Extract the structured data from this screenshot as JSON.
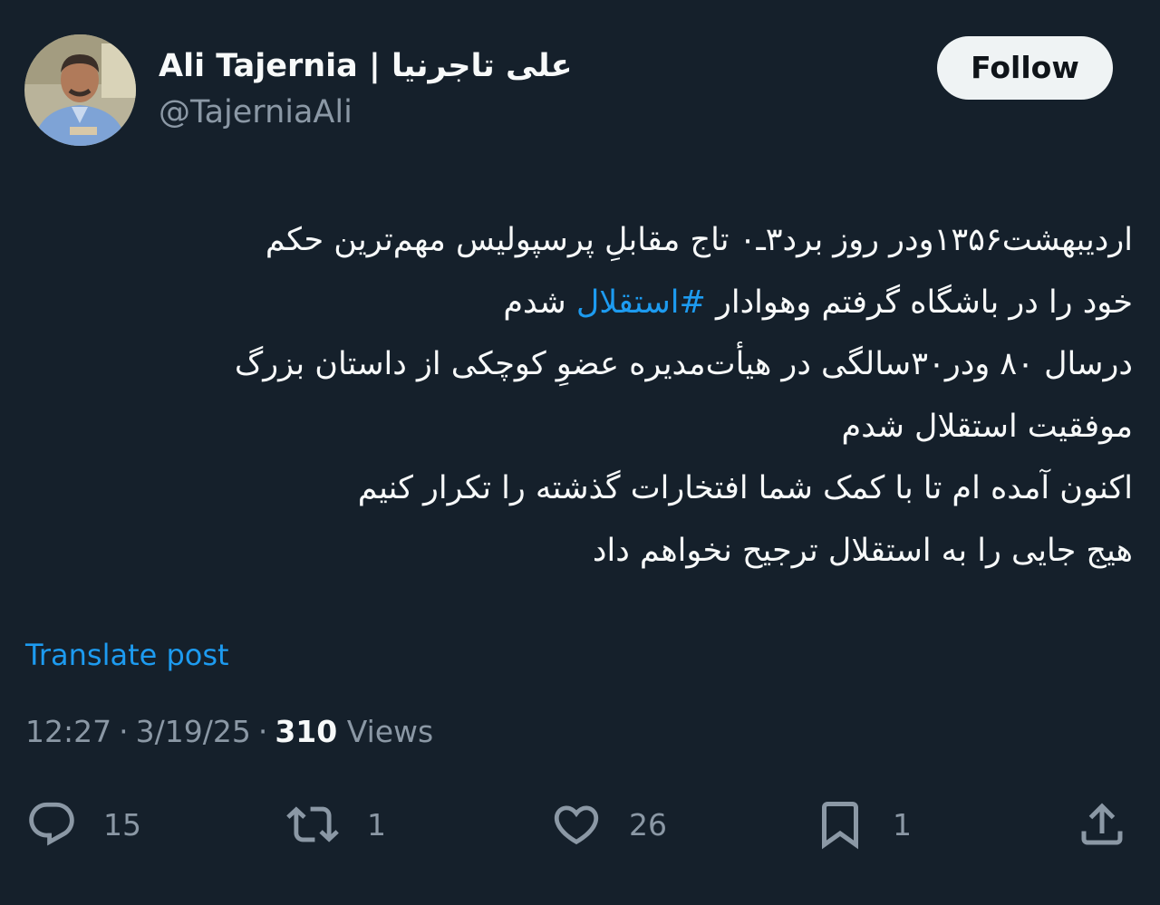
{
  "author": {
    "display_name": "Ali Tajernia | علی تاجرنیا",
    "handle": "@TajerniaAli"
  },
  "follow_label": "Follow",
  "post": {
    "line1": "اردیبهشت۱۳۵۶ودر روز برد۳ـ۰ تاج مقابلِ پرسپولیس مهم‌ترین حکم",
    "line2_text": "خود را در باشگاه گرفتم وهوادار ",
    "hashtag": "#استقلال",
    "line2_tail": " شدم",
    "line3": "درسال ۸۰ ودر۳۰سالگی در هیأت‌مدیره عضوِ کوچکی از داستان بزرگ",
    "line4": "موفقیت استقلال شدم",
    "line5": "اکنون آمده ام تا با کمک شما افتخارات گذشته را تکرار کنیم",
    "line6": "هیج جایی را به استقلال ترجیح نخواهم داد"
  },
  "translate_label": "Translate post",
  "meta": {
    "time": "12:27",
    "date": "3/19/25",
    "separator": "·",
    "views_count": "310",
    "views_label": "Views"
  },
  "actions": {
    "replies": "15",
    "reposts": "1",
    "likes": "26",
    "bookmarks": "1"
  },
  "colors": {
    "background": "#15202b",
    "accent": "#1d9bf0",
    "muted": "#8b98a5",
    "text": "#f7f9f9"
  },
  "icons": [
    "reply-icon",
    "repost-icon",
    "like-icon",
    "bookmark-icon",
    "share-icon"
  ]
}
